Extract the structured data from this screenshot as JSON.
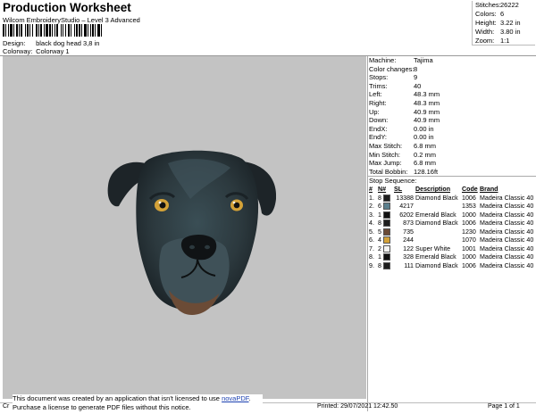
{
  "header": {
    "title": "Production Worksheet",
    "subtitle": "Wilcom EmbroideryStudio – Level 3 Advanced",
    "design_label": "Design:",
    "design_value": "black dog head 3,8 in",
    "colorway_label": "Colorway:",
    "colorway_value": "Colorway 1"
  },
  "stats": [
    {
      "label": "Stitches:",
      "value": "26222"
    },
    {
      "label": "Colors:",
      "value": "6"
    },
    {
      "label": "Height:",
      "value": "3.22 in"
    },
    {
      "label": "Width:",
      "value": "3.80 in"
    },
    {
      "label": "Zoom:",
      "value": "1:1"
    }
  ],
  "machine": [
    {
      "label": "Machine:",
      "value": "Tajima"
    },
    {
      "label": "Color changes:",
      "value": "8"
    },
    {
      "label": "Stops:",
      "value": "9"
    },
    {
      "label": "Trims:",
      "value": "40"
    },
    {
      "label": "Left:",
      "value": "48.3 mm"
    },
    {
      "label": "Right:",
      "value": "48.3 mm"
    },
    {
      "label": "Up:",
      "value": "40.9 mm"
    },
    {
      "label": "Down:",
      "value": "40.9 mm"
    },
    {
      "label": "EndX:",
      "value": "0.00 in"
    },
    {
      "label": "EndY:",
      "value": "0.00 in"
    },
    {
      "label": "Max Stitch:",
      "value": "6.8 mm"
    },
    {
      "label": "Min Stitch:",
      "value": "0.2 mm"
    },
    {
      "label": "Max Jump:",
      "value": "6.8 mm"
    },
    {
      "label": "Total Bobbin:",
      "value": "128.16ft"
    }
  ],
  "sequence": {
    "title": "Stop Sequence:",
    "headers": [
      "#",
      "N#",
      "SL",
      "Description",
      "Code",
      "Brand"
    ],
    "rows": [
      {
        "idx": "1.",
        "n": "8",
        "color": "#1e1e1e",
        "sl": "13388",
        "desc": "Diamond Black",
        "code": "1006",
        "brand": "Madeira Classic 40"
      },
      {
        "idx": "2.",
        "n": "6",
        "color": "#5b7f8d",
        "sl": "4217",
        "desc": "",
        "code": "1353",
        "brand": "Madeira Classic 40"
      },
      {
        "idx": "3.",
        "n": "1",
        "color": "#111111",
        "sl": "6202",
        "desc": "Emerald Black",
        "code": "1000",
        "brand": "Madeira Classic 40"
      },
      {
        "idx": "4.",
        "n": "8",
        "color": "#1e1e1e",
        "sl": "873",
        "desc": "Diamond Black",
        "code": "1006",
        "brand": "Madeira Classic 40"
      },
      {
        "idx": "5.",
        "n": "5",
        "color": "#6b4b36",
        "sl": "735",
        "desc": "",
        "code": "1230",
        "brand": "Madeira Classic 40"
      },
      {
        "idx": "6.",
        "n": "4",
        "color": "#d4a238",
        "sl": "244",
        "desc": "",
        "code": "1070",
        "brand": "Madeira Classic 40"
      },
      {
        "idx": "7.",
        "n": "2",
        "color": "#f4f4f2",
        "sl": "122",
        "desc": "Super White",
        "code": "1001",
        "brand": "Madeira Classic 40"
      },
      {
        "idx": "8.",
        "n": "1",
        "color": "#111111",
        "sl": "328",
        "desc": "Emerald Black",
        "code": "1000",
        "brand": "Madeira Classic 40"
      },
      {
        "idx": "9.",
        "n": "8",
        "color": "#1e1e1e",
        "sl": "111",
        "desc": "Diamond Black",
        "code": "1006",
        "brand": "Madeira Classic 40"
      }
    ]
  },
  "notice": {
    "line1": "This document was created by an application that isn't licensed to use",
    "link": "novaPDF",
    "line1_end": ".",
    "line2": "Purchase a license to generate PDF files without this notice."
  },
  "footer": {
    "left": "Cr",
    "printed": "Printed: 29/07/2021 12:42.50",
    "page": "Page 1 of 1"
  }
}
